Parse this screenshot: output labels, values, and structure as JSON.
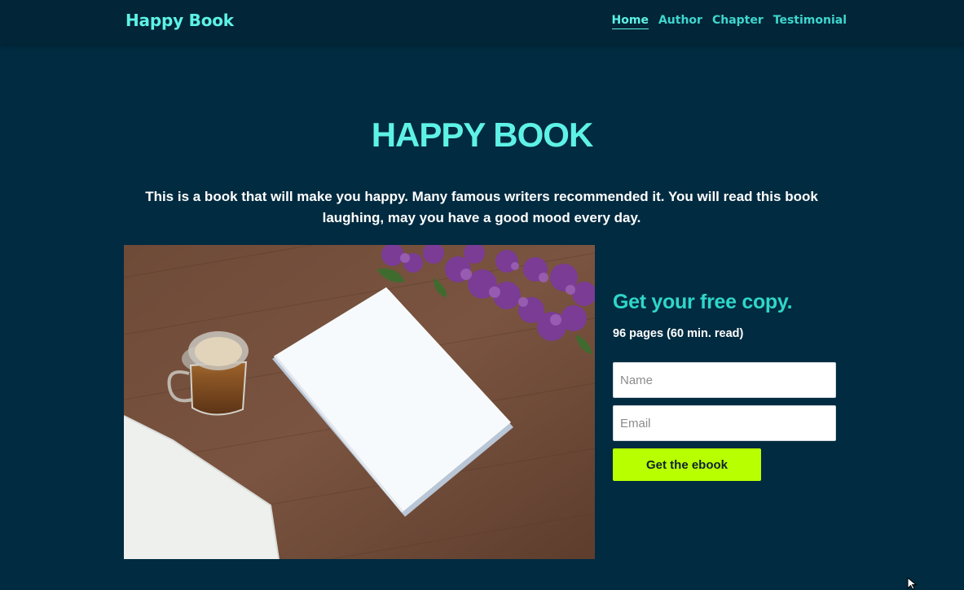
{
  "nav": {
    "brand": "Happy Book",
    "links": [
      "Home",
      "Author",
      "Chapter",
      "Testimonial"
    ],
    "active": "Home"
  },
  "hero": {
    "title": "HAPPY BOOK",
    "description": "This is a book that will make you happy. Many famous writers recommended it. You will read this book laughing, may you have a good mood every day."
  },
  "signup": {
    "title": "Get your free copy.",
    "meta": "96 pages (60 min. read)",
    "name_placeholder": "Name",
    "email_placeholder": "Email",
    "button_label": "Get the ebook"
  },
  "colors": {
    "background": "#012b40",
    "navbar": "#022637",
    "accent": "#5ef2e6",
    "button": "#b8ff00"
  }
}
